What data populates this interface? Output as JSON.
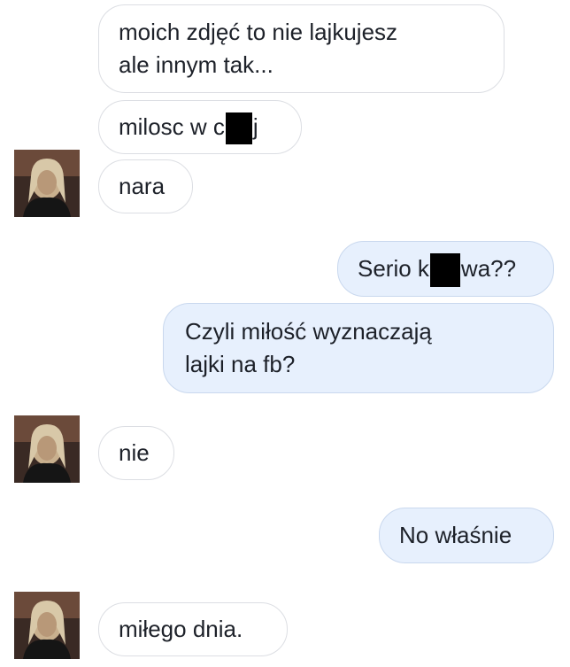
{
  "conversation": {
    "incoming": [
      {
        "lines": [
          "moich zdjęć to nie lajkujesz",
          "ale innym tak..."
        ]
      },
      {
        "before": "milosc w c",
        "after": "j"
      },
      {
        "text": "nara"
      },
      {
        "text": "nie"
      },
      {
        "text": "miłego dnia."
      }
    ],
    "outgoing": [
      {
        "before": "Serio k",
        "after": "wa??"
      },
      {
        "lines": [
          "Czyli miłość wyznaczają",
          "lajki na fb?"
        ]
      },
      {
        "text": "No właśnie"
      }
    ]
  },
  "avatar": {
    "icon": "profile-photo-icon"
  },
  "colors": {
    "incoming_bubble": "#ffffff",
    "incoming_border": "#dcdee3",
    "outgoing_bubble": "#e7f0fd",
    "outgoing_border": "#c9d8ee",
    "text": "#1d2129",
    "censor": "#000000"
  }
}
